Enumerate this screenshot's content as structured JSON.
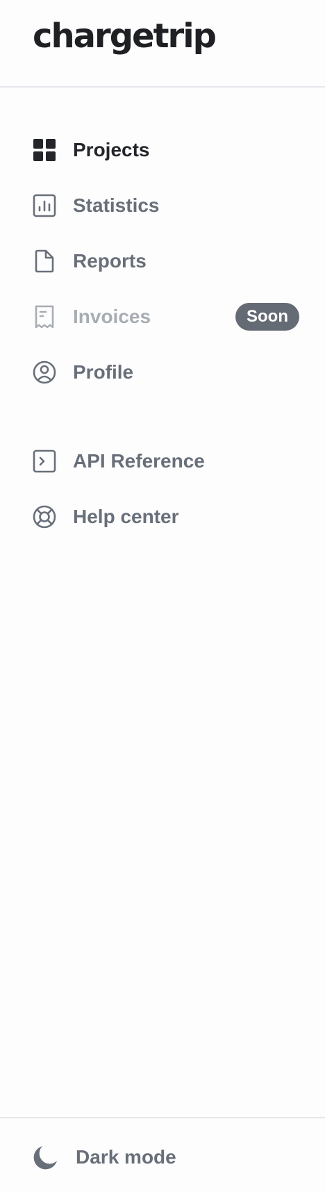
{
  "brand": {
    "name": "chargetrip"
  },
  "nav": {
    "items": [
      {
        "label": "Projects",
        "icon": "grid-icon",
        "active": true
      },
      {
        "label": "Statistics",
        "icon": "bar-chart-icon"
      },
      {
        "label": "Reports",
        "icon": "document-icon"
      },
      {
        "label": "Invoices",
        "icon": "receipt-icon",
        "disabled": true,
        "badge": "Soon"
      },
      {
        "label": "Profile",
        "icon": "user-circle-icon"
      }
    ],
    "secondary": [
      {
        "label": "API Reference",
        "icon": "terminal-icon"
      },
      {
        "label": "Help center",
        "icon": "lifebuoy-icon"
      }
    ]
  },
  "footer": {
    "dark_mode_label": "Dark mode",
    "icon": "moon-icon"
  },
  "colors": {
    "active_text": "#23252a",
    "default_text": "#686f79",
    "disabled_text": "#a8adb4",
    "badge_bg": "#656b74",
    "divider": "#e5e7eb"
  }
}
